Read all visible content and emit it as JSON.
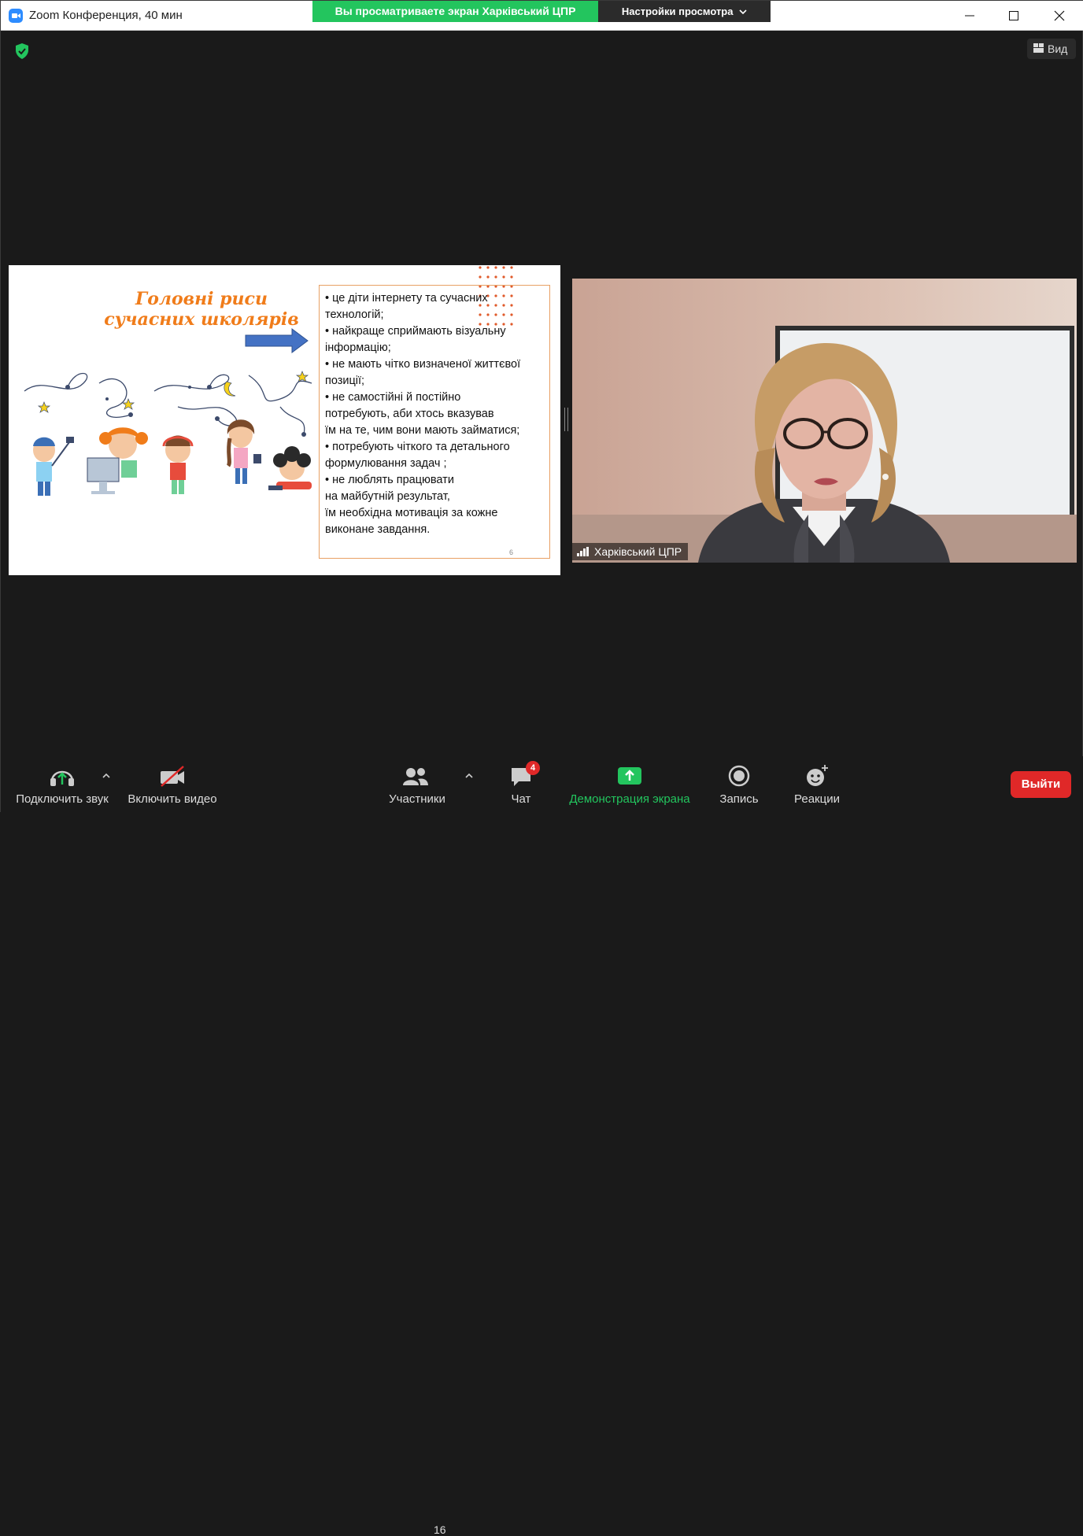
{
  "window": {
    "title": "Zoom Конференция, 40 мин",
    "minimize_icon": "minimize-icon",
    "maximize_icon": "maximize-icon",
    "close_icon": "close-icon"
  },
  "share_banner": {
    "status_text": "Вы просматриваете экран Харківський ЦПР",
    "settings_label": "Настройки просмотра",
    "colors": {
      "status_bg": "#23c55e",
      "settings_bg": "#2b2b2b"
    }
  },
  "view_button": {
    "label": "Вид"
  },
  "slide": {
    "title": "Головні риси сучасних школярів",
    "lines": [
      "•  це діти інтернету та сучасних",
      "технологій;",
      "• найкраще сприймають візуальну",
      "інформацію;",
      "• не мають чітко визначеної життєвої",
      "позиції;",
      "• не самостійні й постійно",
      "потребують, аби хтось вказував",
      "їм на те, чим вони мають  займатися;",
      "• потребують  чіткого  та детального",
      "формулювання  задач ;",
      "• не люблять працювати",
      "на майбутній результат,",
      "їм необхідна мотивація за кожне",
      "виконане завдання."
    ],
    "page_number": "6",
    "accent_color": "#f07c1a"
  },
  "video_tile": {
    "participant_name": "Харківський ЦПР"
  },
  "toolbar": {
    "audio_label": "Подключить звук",
    "video_label": "Включить видео",
    "participants_label": "Участники",
    "participants_count": "16",
    "chat_label": "Чат",
    "chat_badge": "4",
    "share_label": "Демонстрация экрана",
    "record_label": "Запись",
    "reactions_label": "Реакции",
    "exit_label": "Выйти",
    "colors": {
      "share_green": "#23c55e",
      "exit_red": "#e02828"
    }
  }
}
